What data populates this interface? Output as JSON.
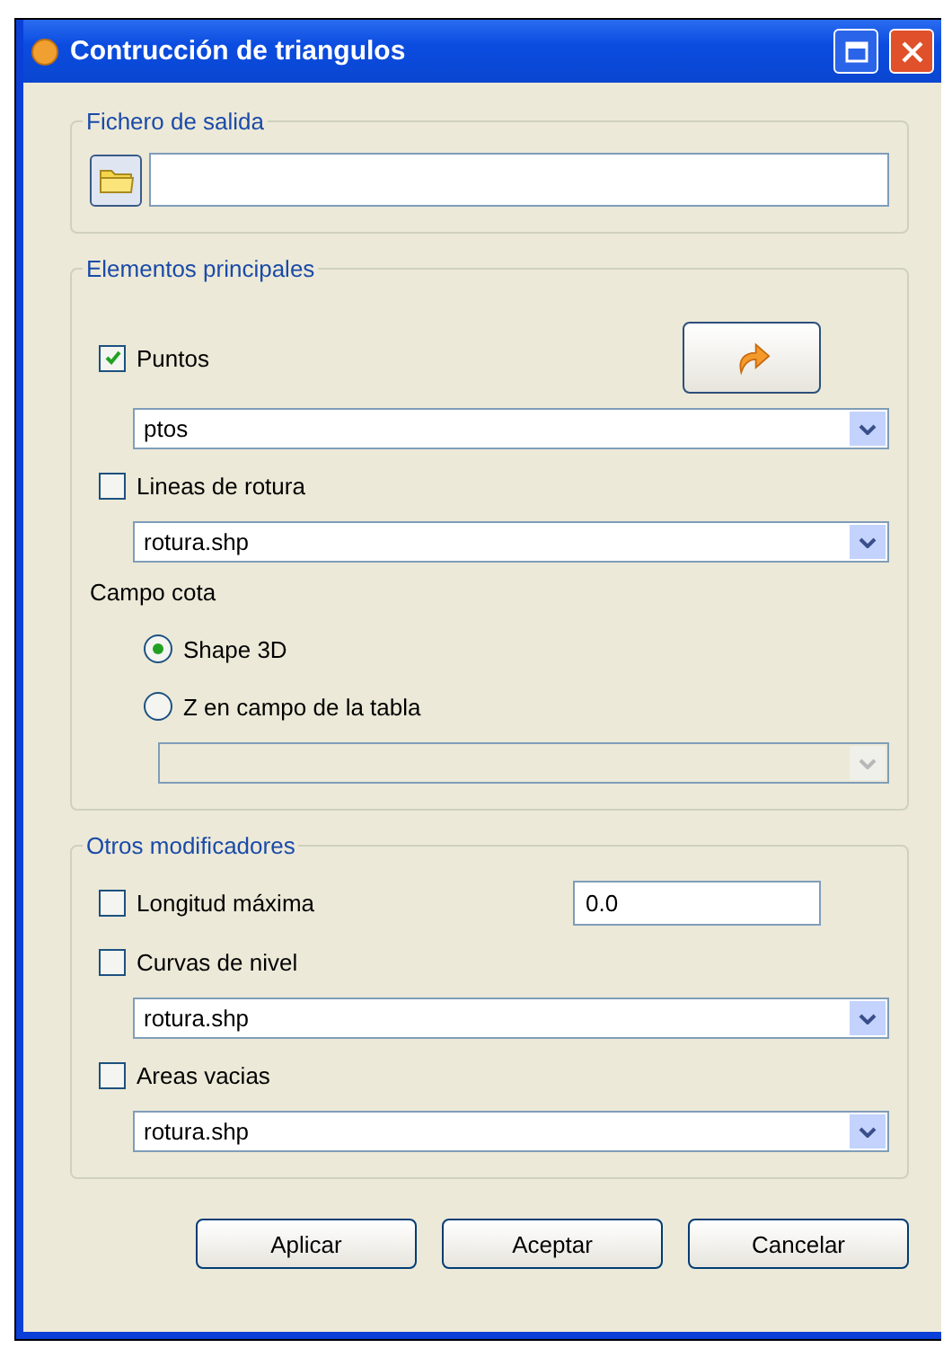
{
  "window": {
    "title": "Contrucción de triangulos"
  },
  "output_group": {
    "legend": "Fichero de salida"
  },
  "main_group": {
    "legend": "Elementos principales",
    "items": [
      {
        "kind": "checkbox",
        "label": "Puntos",
        "checked": true,
        "action_button": true
      },
      {
        "kind": "combo",
        "value": "ptos",
        "disabled": false
      },
      {
        "kind": "checkbox",
        "label": "Lineas de rotura",
        "checked": false
      },
      {
        "kind": "combo",
        "value": "rotura.shp",
        "disabled": false
      },
      {
        "kind": "label",
        "label": "Campo cota"
      },
      {
        "kind": "radio",
        "label": "Shape 3D",
        "selected": true
      },
      {
        "kind": "radio",
        "label": "Z en campo de la tabla",
        "selected": false
      },
      {
        "kind": "combo",
        "disabled": true
      }
    ]
  },
  "modifiers_group": {
    "legend": "Otros modificadores",
    "items": [
      {
        "kind": "checkbox",
        "label": "Longitud máxima",
        "checked": false,
        "value": "0.0"
      },
      {
        "kind": "checkbox",
        "label": "Curvas de nivel",
        "checked": false
      },
      {
        "kind": "combo",
        "value": "rotura.shp",
        "disabled": false
      },
      {
        "kind": "checkbox",
        "label": "Areas vacias",
        "checked": false
      },
      {
        "kind": "combo",
        "value": "rotura.shp",
        "disabled": false
      }
    ]
  },
  "buttons": [
    "Aplicar",
    "Aceptar",
    "Cancelar"
  ]
}
